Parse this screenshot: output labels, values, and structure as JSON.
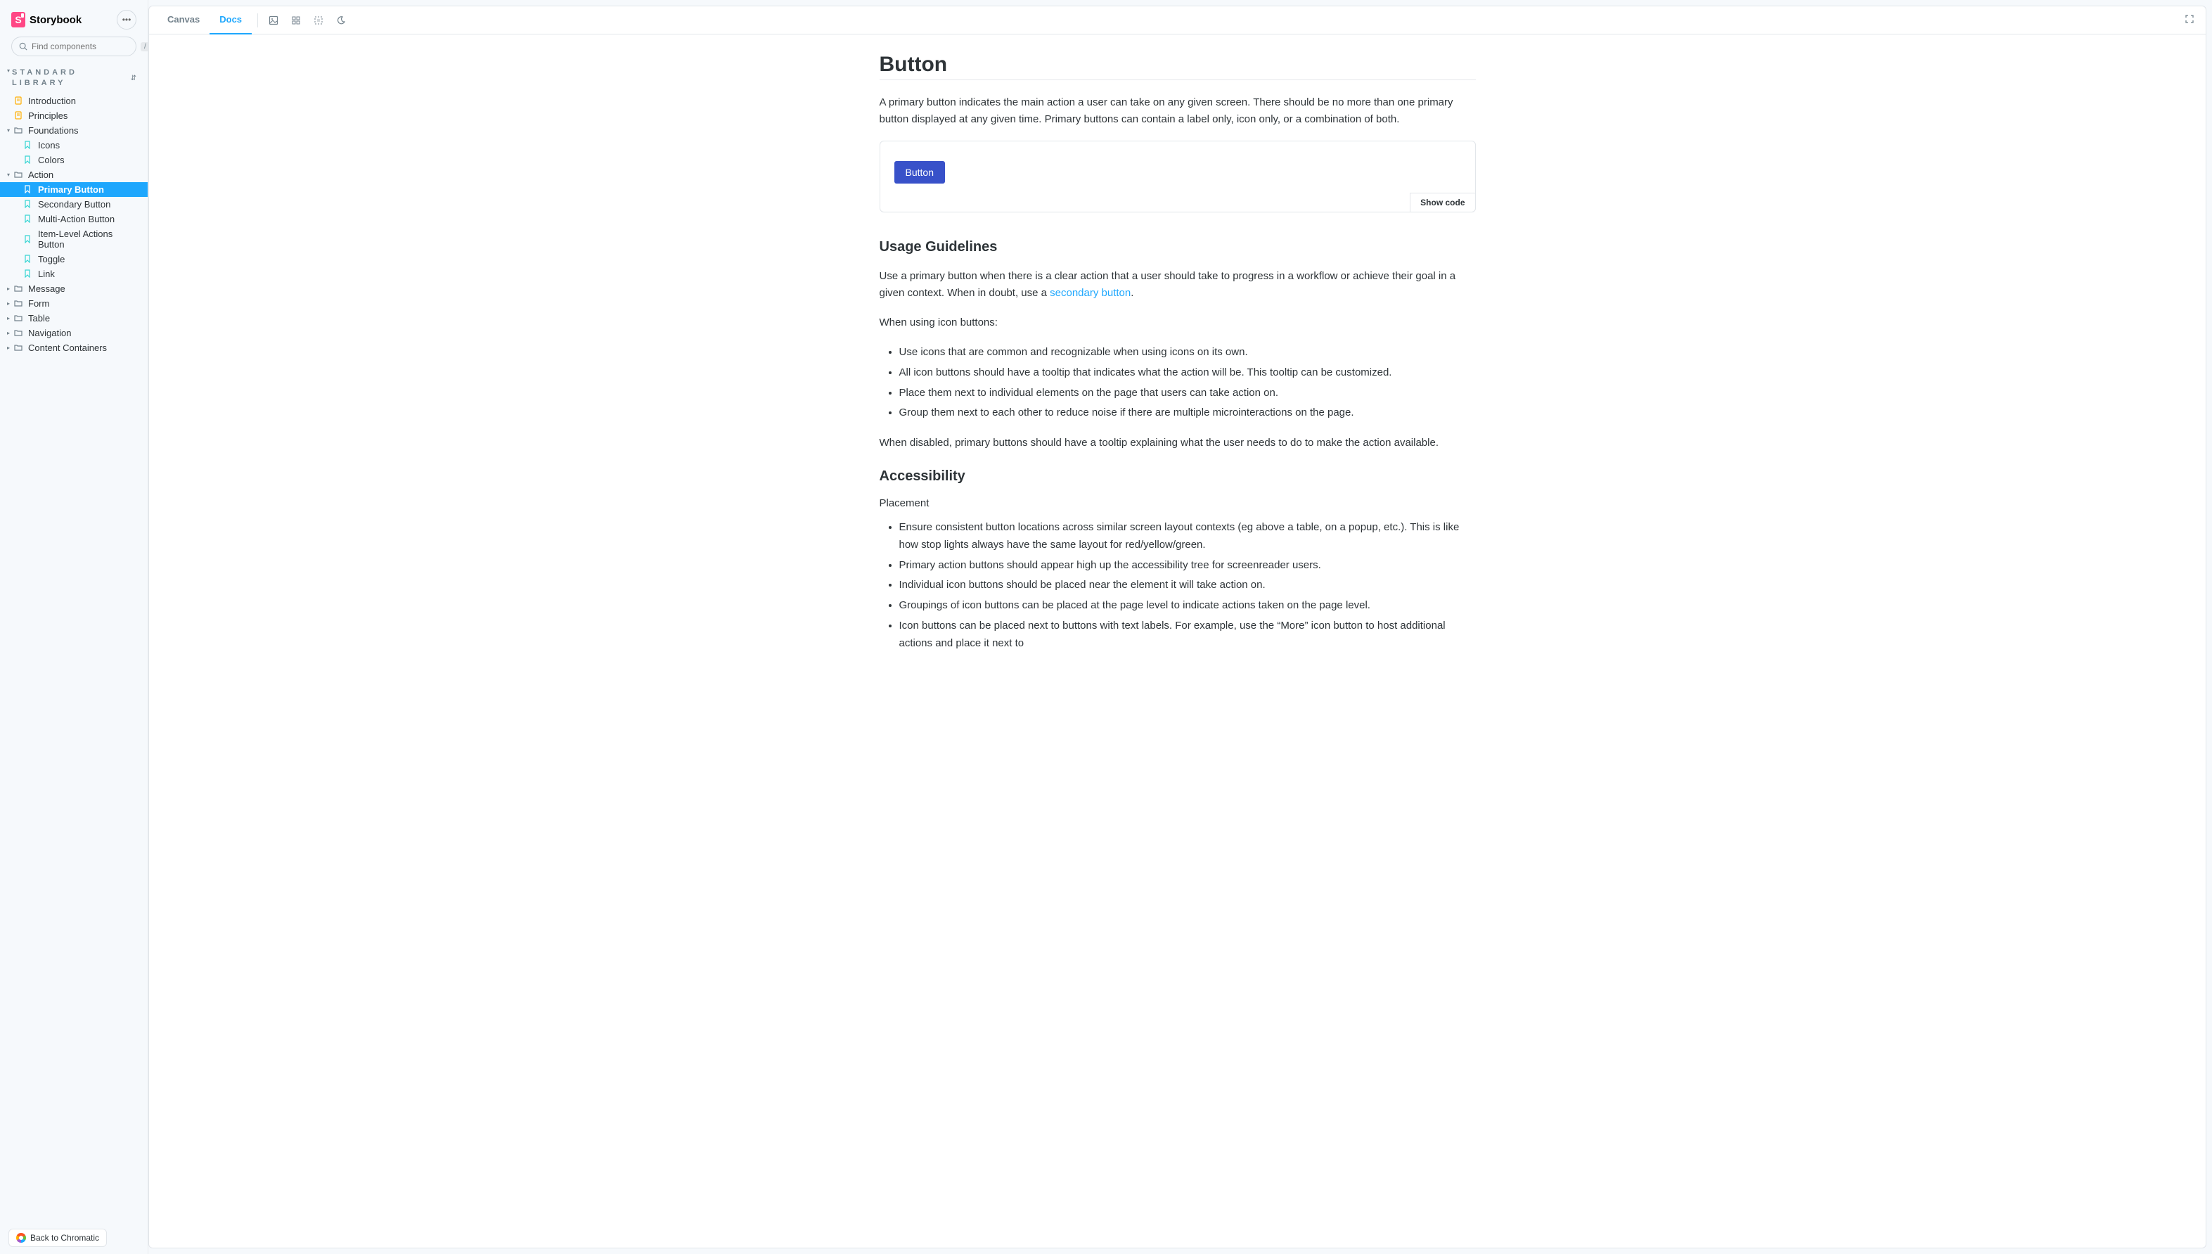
{
  "brand": {
    "name": "Storybook"
  },
  "search": {
    "placeholder": "Find components",
    "shortcut": "/"
  },
  "section_title": "STANDARD LIBRARY",
  "tree": {
    "introduction": "Introduction",
    "principles": "Principles",
    "foundations": "Foundations",
    "foundations_children": {
      "icons": "Icons",
      "colors": "Colors"
    },
    "action": "Action",
    "action_children": {
      "primary_button": "Primary Button",
      "secondary_button": "Secondary Button",
      "multi_action_button": "Multi-Action Button",
      "item_level_actions_button": "Item-Level Actions Button",
      "toggle": "Toggle",
      "link": "Link"
    },
    "message": "Message",
    "form": "Form",
    "table": "Table",
    "navigation": "Navigation",
    "content_containers": "Content Containers"
  },
  "back_chromatic": "Back to Chromatic",
  "toolbar": {
    "tabs": {
      "canvas": "Canvas",
      "docs": "Docs"
    }
  },
  "doc": {
    "title": "Button",
    "intro": "A primary button indicates the main action a user can take on any given screen. There should be no more than one primary button displayed at any given time. Primary buttons can contain a label only, icon only, or a combination of both.",
    "demo_button_label": "Button",
    "show_code": "Show code",
    "usage_heading": "Usage Guidelines",
    "usage_p1_pre": "Use a primary button when there is a clear action that a user should take to progress in a workflow or achieve their goal in a given context. When in doubt, use a ",
    "usage_link": "secondary button",
    "usage_p1_post": ".",
    "usage_p2": "When using icon buttons:",
    "usage_bullets": [
      "Use icons that are common and recognizable when using icons on its own.",
      "All icon buttons should have a tooltip that indicates what the action will be. This tooltip can be customized.",
      "Place them next to individual elements on the page that users can take action on.",
      "Group them next to each other to reduce noise if there are multiple microinteractions on the page."
    ],
    "usage_p3": "When disabled, primary buttons should have a tooltip explaining what the user needs to do to make the action available.",
    "a11y_heading": "Accessibility",
    "a11y_sub1": "Placement",
    "a11y_bullets": [
      "Ensure consistent button locations across similar screen layout contexts (eg above a table, on a popup, etc.). This is like how stop lights always have the same layout for red/yellow/green.",
      "Primary action buttons should appear high up the accessibility tree for screenreader users.",
      "Individual icon buttons should be placed near the element it will take action on.",
      "Groupings of icon buttons can be placed at the page level to indicate actions taken on the page level.",
      "Icon buttons can be placed next to buttons with text labels. For example, use the “More” icon button to host additional actions and place it next to"
    ]
  }
}
